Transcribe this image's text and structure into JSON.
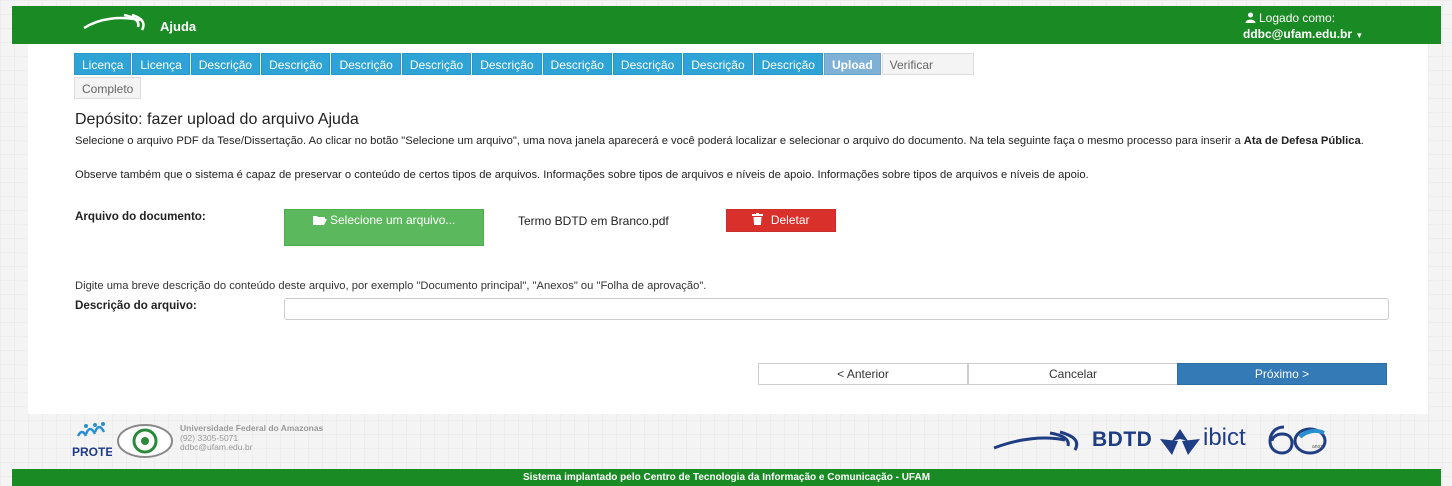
{
  "header": {
    "app_title": "Ajuda",
    "logged_label": "Logado como:",
    "user_email": "ddbc@ufam.edu.br"
  },
  "tabs": [
    {
      "label": "Licença"
    },
    {
      "label": "Licença"
    },
    {
      "label": "Descrição"
    },
    {
      "label": "Descrição"
    },
    {
      "label": "Descrição"
    },
    {
      "label": "Descrição"
    },
    {
      "label": "Descrição"
    },
    {
      "label": "Descrição"
    },
    {
      "label": "Descrição"
    },
    {
      "label": "Descrição"
    },
    {
      "label": "Descrição"
    },
    {
      "label": "Upload",
      "active": true
    },
    {
      "label": "Verificar"
    },
    {
      "label": "Completo"
    }
  ],
  "main": {
    "title": "Depósito: fazer upload do arquivo Ajuda",
    "para1_prefix": "Selecione o arquivo PDF da Tese/Dissertação. Ao clicar no botão \"Selecione um arquivo\", uma nova janela aparecerá e você poderá localizar e selecionar o arquivo do documento. Na tela seguinte faça o mesmo processo para inserir a ",
    "para1_bold": "Ata de Defesa Pública",
    "para1_suffix": ".",
    "para2": "Observe também que o sistema é capaz de preservar o conteúdo de certos tipos de arquivos. Informações sobre tipos de arquivos e níveis de apoio. Informações sobre tipos de arquivos e níveis de apoio.",
    "file_label": "Arquivo do documento:",
    "select_button": "Selecione um arquivo...",
    "file_name": "Termo BDTD em Branco.pdf",
    "delete_button": "Deletar",
    "description_hint": "Digite uma breve descrição do conteúdo deste arquivo, por exemplo \"Documento principal\", \"Anexos\" ou \"Folha de aprovação\".",
    "description_label": "Descrição do arquivo:",
    "description_value": "",
    "prev_button": "< Anterior",
    "cancel_button": "Cancelar",
    "next_button": "Próximo >"
  },
  "footer": {
    "protec": "PROTEC",
    "institution_name": "Universidade Federal do Amazonas",
    "institution_phone": "(92) 3305-5071",
    "institution_email": "ddbc@ufam.edu.br",
    "bdtd": "BDTD",
    "ibict": "ibict",
    "ibict_years": "anos",
    "bottom_text": "Sistema implantado pelo Centro de Tecnologia da Informação e Comunicação - UFAM"
  },
  "colors": {
    "brand_green": "#1a8a24",
    "tab_blue": "#2ea4d6",
    "success": "#5cb85c",
    "danger": "#d9302b",
    "primary": "#337ab7"
  }
}
